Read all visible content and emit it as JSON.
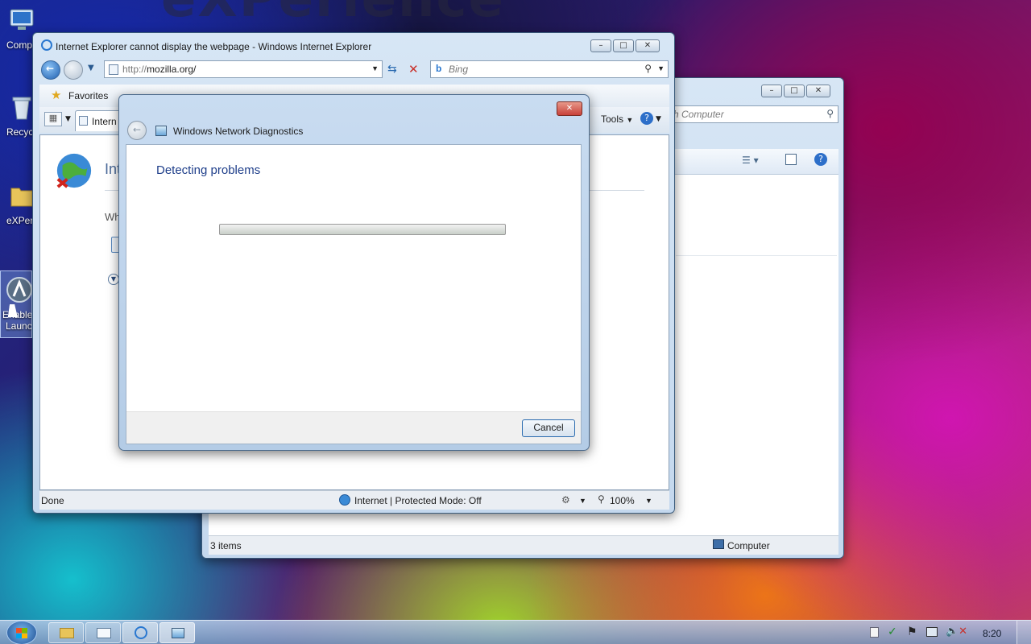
{
  "desktop": {
    "wallpaper_text": "eXPerience",
    "icons": [
      {
        "label": "Comp"
      },
      {
        "label": "Recyc"
      },
      {
        "label": "eXPer"
      },
      {
        "label": "Enable"
      },
      {
        "label": "Launc"
      }
    ]
  },
  "ie": {
    "title": "Internet Explorer cannot display the webpage - Windows Internet Explorer",
    "address_prefix": "http://",
    "address_host": "mozilla.org/",
    "search_placeholder": "Bing",
    "favorites_label": "Favorites",
    "tab_label": "Intern",
    "tools_label": "Tools",
    "page_heading": "Int",
    "page_text": "Wh",
    "status_done": "Done",
    "status_zone": "Internet | Protected Mode: Off",
    "zoom": "100%"
  },
  "explorer": {
    "search_placeholder": "h Computer",
    "item_count": "3 items",
    "status_location": "Computer"
  },
  "dialog": {
    "title": "Windows Network Diagnostics",
    "heading": "Detecting problems",
    "progress": 0.0,
    "cancel_label": "Cancel"
  },
  "taskbar": {
    "time": "8:20"
  },
  "colors": {
    "dialog_heading": "#1e3e8a",
    "window_frame": "#c4d8ee",
    "close_button": "#c8413a"
  }
}
